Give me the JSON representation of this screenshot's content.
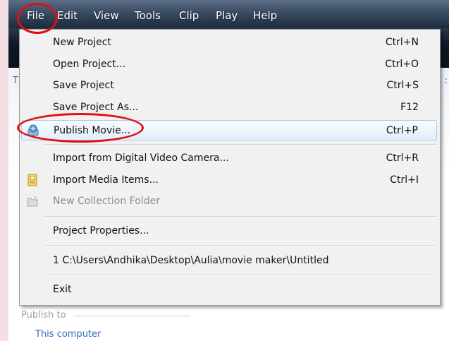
{
  "menubar": {
    "items": [
      {
        "label": "File"
      },
      {
        "label": "Edit"
      },
      {
        "label": "View"
      },
      {
        "label": "Tools"
      },
      {
        "label": "Clip"
      },
      {
        "label": "Play"
      },
      {
        "label": "Help"
      }
    ]
  },
  "background": {
    "partial_left": "T",
    "partial_right": ":",
    "publish_to": "Publish to",
    "this_computer": "This computer"
  },
  "file_menu": {
    "items": [
      {
        "label": "New Project",
        "shortcut": "Ctrl+N"
      },
      {
        "label": "Open Project...",
        "shortcut": "Ctrl+O"
      },
      {
        "label": "Save Project",
        "shortcut": "Ctrl+S"
      },
      {
        "label": "Save Project As...",
        "shortcut": "F12"
      },
      {
        "label": "Publish Movie...",
        "shortcut": "Ctrl+P",
        "icon": "publish-movie-icon"
      },
      {
        "label": "Import from Digital Video Camera...",
        "shortcut": "Ctrl+R"
      },
      {
        "label": "Import Media Items...",
        "shortcut": "Ctrl+I",
        "icon": "import-media-icon"
      },
      {
        "label": "New Collection Folder",
        "shortcut": "",
        "icon": "new-folder-icon",
        "disabled": true
      },
      {
        "label": "Project Properties...",
        "shortcut": ""
      },
      {
        "label": "1 C:\\Users\\Andhika\\Desktop\\Aulia\\movie maker\\Untitled",
        "shortcut": ""
      },
      {
        "label": "Exit",
        "shortcut": ""
      }
    ]
  },
  "colors": {
    "annotation": "#e01010",
    "link": "#2f6bb8",
    "hover_border": "#a9c7ea"
  }
}
